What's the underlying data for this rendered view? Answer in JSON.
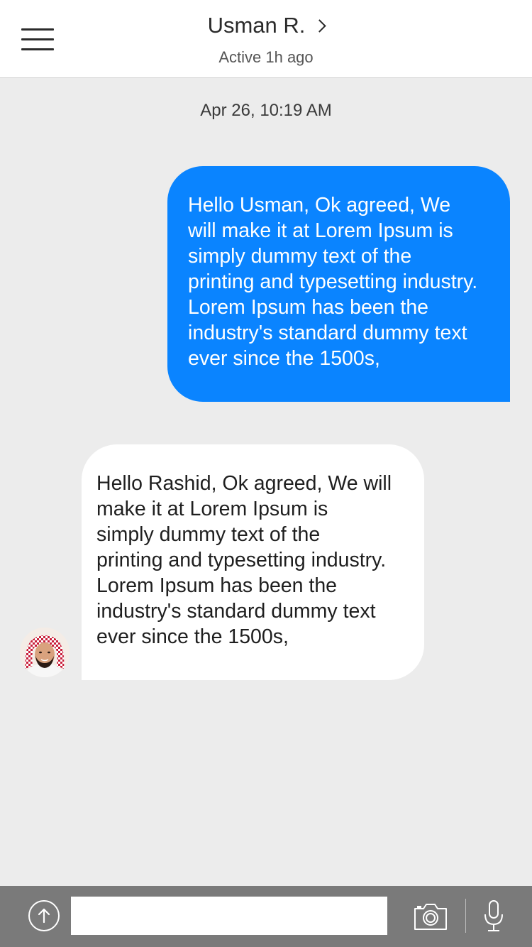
{
  "header": {
    "contact_name": "Usman R.",
    "status": "Active 1h ago"
  },
  "chat": {
    "timestamp": "Apr 26, 10:19 AM",
    "messages": [
      {
        "direction": "outgoing",
        "lines": [
          "Hello Usman, Ok agreed, We",
          "will make it at Lorem Ipsum is",
          "simply dummy text of the",
          "printing and typesetting industry.",
          "Lorem Ipsum has been the",
          "industry's standard dummy text",
          "ever since the 1500s,"
        ]
      },
      {
        "direction": "incoming",
        "lines": [
          "Hello Rashid, Ok agreed, We will",
          "make it at Lorem Ipsum is",
          "simply dummy text of the",
          "printing and typesetting industry.",
          "Lorem Ipsum has been the",
          "industry's standard dummy text",
          "ever since the 1500s,"
        ]
      }
    ]
  },
  "composer": {
    "input_value": "",
    "icons": [
      "upload-arrow-icon",
      "camera-icon",
      "microphone-icon"
    ]
  },
  "colors": {
    "outgoing_bubble": "#0a84ff",
    "incoming_bubble": "#ffffff",
    "background": "#ececec",
    "bottom_bar": "#7a7a7a"
  }
}
